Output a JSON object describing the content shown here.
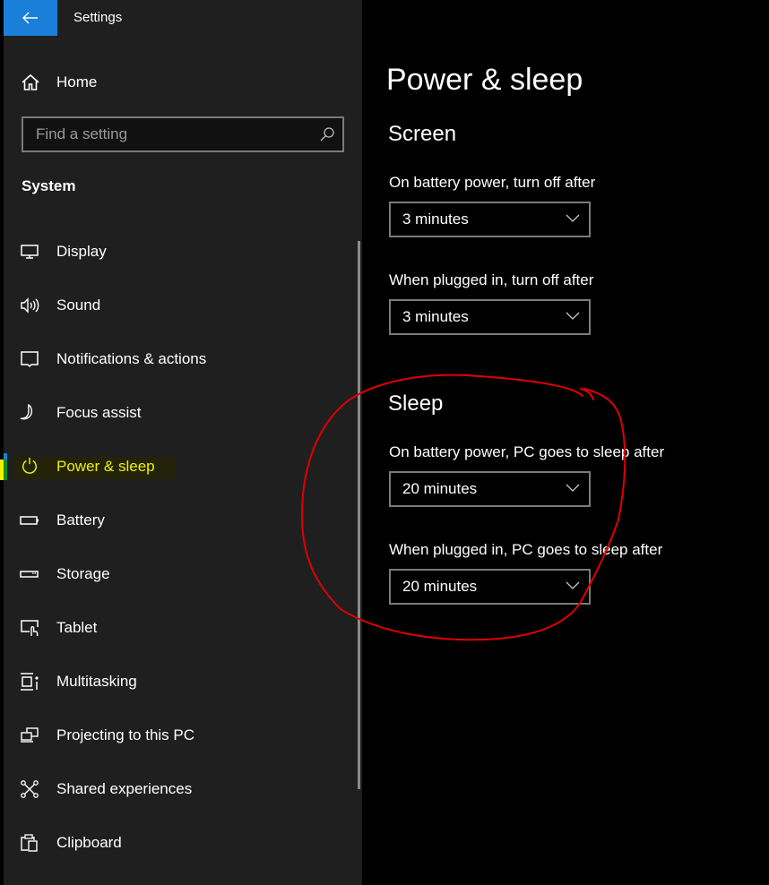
{
  "window": {
    "app_title": "Settings",
    "back_icon": "arrow-left-icon"
  },
  "sidebar": {
    "home": {
      "label": "Home",
      "icon": "home-icon"
    },
    "search": {
      "placeholder": "Find a setting",
      "value": "",
      "icon": "search-icon"
    },
    "section_title": "System",
    "items": [
      {
        "label": "Display",
        "icon": "monitor-icon",
        "selected": false
      },
      {
        "label": "Sound",
        "icon": "speaker-icon",
        "selected": false
      },
      {
        "label": "Notifications & actions",
        "icon": "notification-icon",
        "selected": false
      },
      {
        "label": "Focus assist",
        "icon": "moon-icon",
        "selected": false
      },
      {
        "label": "Power & sleep",
        "icon": "power-icon",
        "selected": true
      },
      {
        "label": "Battery",
        "icon": "battery-icon",
        "selected": false
      },
      {
        "label": "Storage",
        "icon": "storage-icon",
        "selected": false
      },
      {
        "label": "Tablet",
        "icon": "tablet-icon",
        "selected": false
      },
      {
        "label": "Multitasking",
        "icon": "multitasking-icon",
        "selected": false
      },
      {
        "label": "Projecting to this PC",
        "icon": "projecting-icon",
        "selected": false
      },
      {
        "label": "Shared experiences",
        "icon": "shared-experiences-icon",
        "selected": false
      },
      {
        "label": "Clipboard",
        "icon": "clipboard-icon",
        "selected": false
      }
    ]
  },
  "main": {
    "title": "Power & sleep",
    "screen": {
      "heading": "Screen",
      "battery_label": "On battery power, turn off after",
      "battery_value": "3 minutes",
      "plugged_label": "When plugged in, turn off after",
      "plugged_value": "3 minutes"
    },
    "sleep": {
      "heading": "Sleep",
      "battery_label": "On battery power, PC goes to sleep after",
      "battery_value": "20 minutes",
      "plugged_label": "When plugged in, PC goes to sleep after",
      "plugged_value": "20 minutes"
    }
  },
  "colors": {
    "accent": "#1a7fd8",
    "sidebar_bg": "#1f1f1f",
    "content_bg": "#000000",
    "highlight_text": "#f0f000",
    "annotation": "#e00000"
  }
}
